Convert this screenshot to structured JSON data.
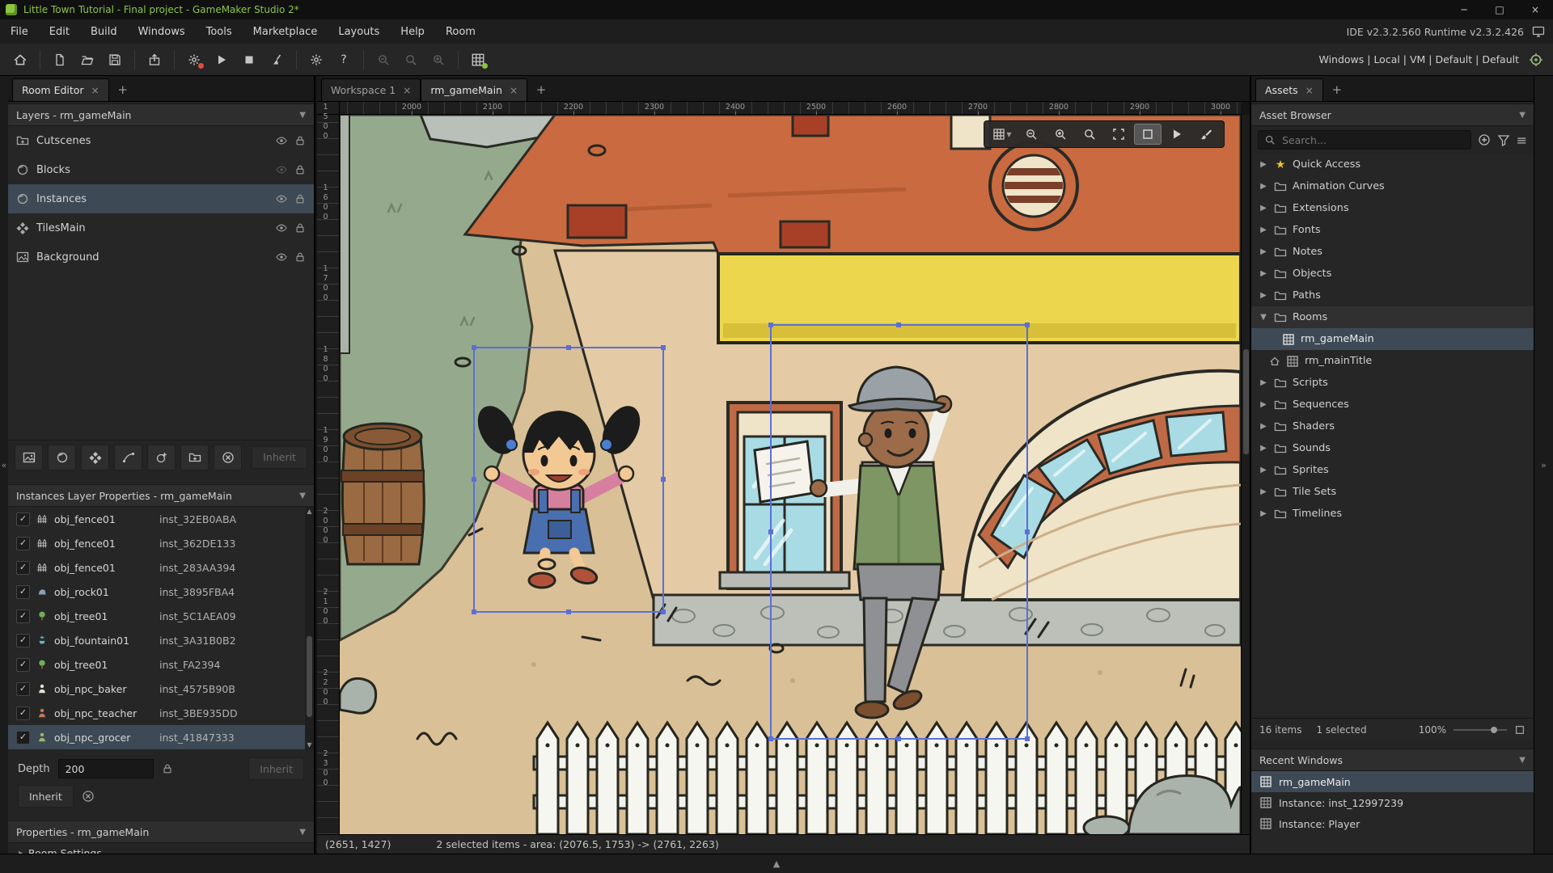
{
  "window": {
    "title": "Little Town Tutorial - Final project - GameMaker Studio 2*"
  },
  "menubar": {
    "items": [
      "File",
      "Edit",
      "Build",
      "Windows",
      "Tools",
      "Marketplace",
      "Layouts",
      "Help",
      "Room"
    ],
    "version": "IDE v2.3.2.560 Runtime v2.3.2.426"
  },
  "toolbar": {
    "targets": "Windows | Local | VM | Default | Default"
  },
  "left": {
    "tab": "Room Editor",
    "layers_header": "Layers - rm_gameMain",
    "layers": [
      {
        "name": "Cutscenes"
      },
      {
        "name": "Blocks"
      },
      {
        "name": "Instances"
      },
      {
        "name": "TilesMain"
      },
      {
        "name": "Background"
      }
    ],
    "inherit": "Inherit",
    "instances_header": "Instances Layer Properties - rm_gameMain",
    "instances": [
      {
        "obj": "obj_fence01",
        "id": "inst_32EB0ABA"
      },
      {
        "obj": "obj_fence01",
        "id": "inst_362DE133"
      },
      {
        "obj": "obj_fence01",
        "id": "inst_283AA394"
      },
      {
        "obj": "obj_rock01",
        "id": "inst_3895FBA4"
      },
      {
        "obj": "obj_tree01",
        "id": "inst_5C1AEA09"
      },
      {
        "obj": "obj_fountain01",
        "id": "inst_3A31B0B2"
      },
      {
        "obj": "obj_tree01",
        "id": "inst_FA2394"
      },
      {
        "obj": "obj_npc_baker",
        "id": "inst_4575B90B"
      },
      {
        "obj": "obj_npc_teacher",
        "id": "inst_3BE935DD"
      },
      {
        "obj": "obj_npc_grocer",
        "id": "inst_41847333"
      }
    ],
    "depth_label": "Depth",
    "depth_value": "200",
    "inherit2": "Inherit",
    "inherit3": "Inherit",
    "properties_header": "Properties - rm_gameMain",
    "room_settings": "Room Settings"
  },
  "workspace": {
    "tabs": [
      {
        "label": "Workspace 1"
      },
      {
        "label": "rm_gameMain"
      }
    ],
    "ruler_h": [
      "2000",
      "2100",
      "2200",
      "2300",
      "2400",
      "2500",
      "2600",
      "2700",
      "2800",
      "2900",
      "3000"
    ],
    "ruler_v": [
      "1500",
      "1600",
      "1700",
      "1800",
      "1900",
      "2000",
      "2100",
      "2200",
      "2300"
    ],
    "status_coords": "(2651, 1427)",
    "status_selection": "2 selected items - area: (2076.5, 1753) -> (2761, 2263)"
  },
  "assets": {
    "tab": "Assets",
    "browser": "Asset Browser",
    "search_placeholder": "Search...",
    "tree": [
      {
        "label": "Quick Access"
      },
      {
        "label": "Animation Curves"
      },
      {
        "label": "Extensions"
      },
      {
        "label": "Fonts"
      },
      {
        "label": "Notes"
      },
      {
        "label": "Objects"
      },
      {
        "label": "Paths"
      },
      {
        "label": "Rooms"
      },
      {
        "label": "rm_gameMain"
      },
      {
        "label": "rm_mainTitle"
      },
      {
        "label": "Scripts"
      },
      {
        "label": "Sequences"
      },
      {
        "label": "Shaders"
      },
      {
        "label": "Sounds"
      },
      {
        "label": "Sprites"
      },
      {
        "label": "Tile Sets"
      },
      {
        "label": "Timelines"
      }
    ],
    "footer_items": "16 items",
    "footer_selected": "1 selected",
    "footer_zoom": "100%",
    "recent_header": "Recent Windows",
    "recent": [
      {
        "label": "rm_gameMain"
      },
      {
        "label": "Instance: inst_12997239"
      },
      {
        "label": "Instance: Player"
      }
    ]
  },
  "colors": {
    "selection_row": "#3d4a55",
    "title_green": "#8fc34d",
    "canvas_selection": "#5a6fd8",
    "grass": "#95aa8c",
    "ground": "#d9c096",
    "roof": "#c96a40",
    "banner_yellow": "#ecd64d"
  }
}
